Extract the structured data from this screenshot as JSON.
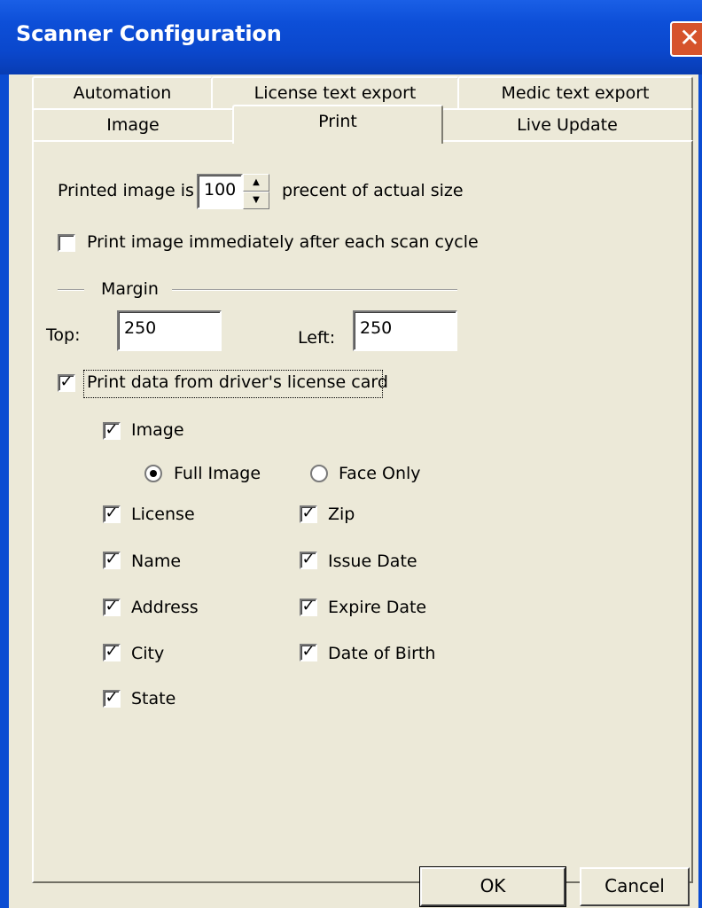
{
  "window": {
    "title": "Scanner Configuration",
    "close_glyph": "✕"
  },
  "tabs_row1": [
    "Automation",
    "License text export",
    "Medic text export"
  ],
  "tabs_row2": [
    "Image",
    "Print",
    "Live Update"
  ],
  "print": {
    "printed_prefix": "Printed image is",
    "printed_value": "100",
    "printed_suffix": "precent of actual size",
    "print_immediately": "Print image immediately after each scan cycle",
    "margin_title": "Margin",
    "top_label": "Top:",
    "top_value": "250",
    "left_label": "Left:",
    "left_value": "250",
    "print_data": "Print data from driver's license card",
    "image": "Image",
    "full_image": "Full Image",
    "face_only": "Face Only",
    "license": "License",
    "name": "Name",
    "address": "Address",
    "city": "City",
    "state": "State",
    "zip": "Zip",
    "issue_date": "Issue Date",
    "expire_date": "Expire Date",
    "date_of_birth": "Date of Birth"
  },
  "buttons": {
    "ok": "OK",
    "cancel": "Cancel"
  }
}
